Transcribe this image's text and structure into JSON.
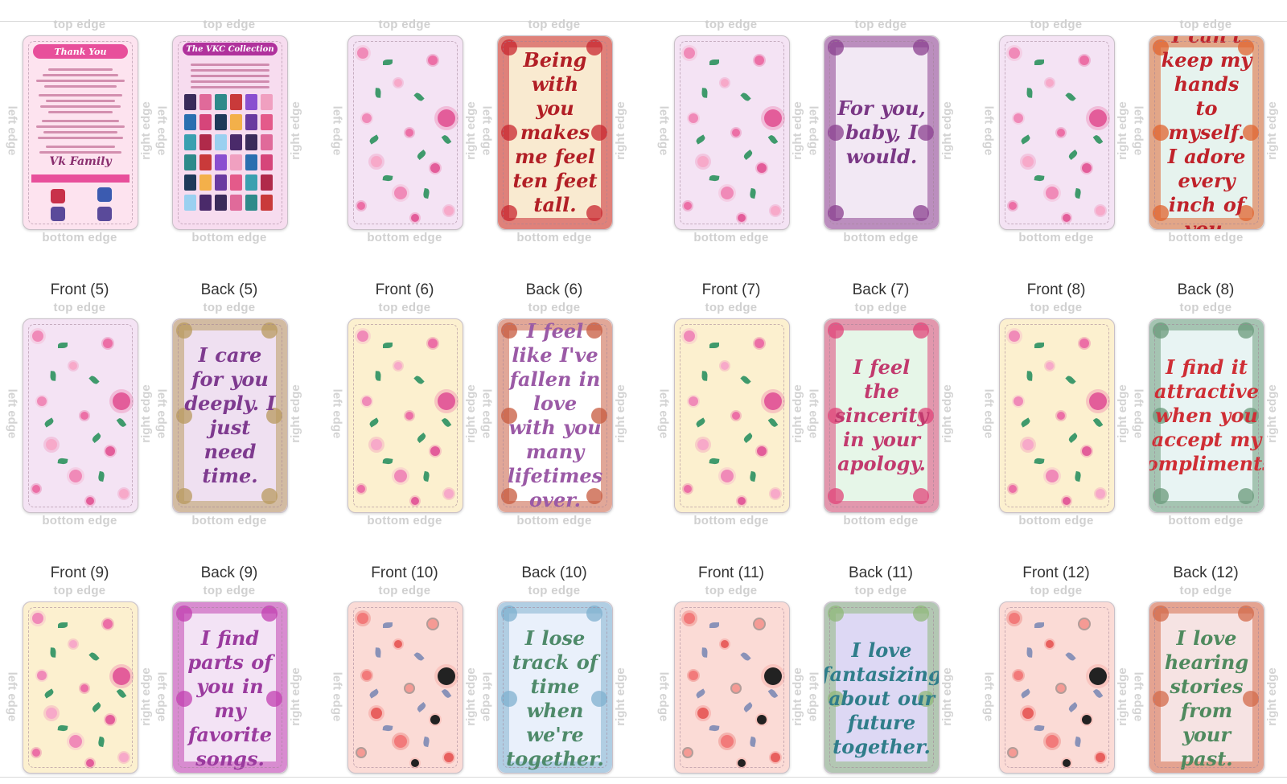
{
  "edge_labels": {
    "top": "top edge",
    "bottom": "bottom edge",
    "left": "left edge",
    "right": "right edge"
  },
  "rows": [
    {
      "slots": [
        {
          "label": "",
          "type": "thankyou",
          "header": "Thank You",
          "sign": "Vk Family"
        },
        {
          "label": "",
          "type": "collection",
          "header": "The VKC Collection"
        },
        {
          "label": "",
          "type": "pattern",
          "pattern": "lilac"
        },
        {
          "label": "",
          "type": "quote",
          "text": "Being with you makes me feel ten feet tall.",
          "bg": "#f9ead0",
          "border": "#c8262f",
          "color": "#b21f26"
        },
        {
          "label": "",
          "type": "pattern",
          "pattern": "lilac"
        },
        {
          "label": "",
          "type": "quote",
          "text": "For you, baby, I would.",
          "bg": "#f2e8f4",
          "border": "#8a3f8f",
          "color": "#7a3785"
        },
        {
          "label": "",
          "type": "pattern",
          "pattern": "lilac"
        },
        {
          "label": "",
          "type": "quote",
          "text": "I can't keep my hands to myself. I adore every inch of you.",
          "bg": "#e6f3ee",
          "border": "#e0632e",
          "color": "#c0222a"
        }
      ]
    },
    {
      "slots": [
        {
          "label": "Front (5)",
          "type": "pattern",
          "pattern": "lilac"
        },
        {
          "label": "Back (5)",
          "type": "quote",
          "text": "I care for you deeply. I just need time.",
          "bg": "#efe0f1",
          "border": "#b89a5e",
          "color": "#7e3a8f"
        },
        {
          "label": "Front (6)",
          "type": "pattern",
          "pattern": "cream"
        },
        {
          "label": "Back (6)",
          "type": "quote",
          "text": "I feel like I've fallen in love with you many lifetimes over.",
          "bg": "#ffffff",
          "border": "#c75a3e",
          "color": "#9b5aa6"
        },
        {
          "label": "Front (7)",
          "type": "pattern",
          "pattern": "cream"
        },
        {
          "label": "Back (7)",
          "type": "quote",
          "text": "I feel the sincerity in your apology.",
          "bg": "#e6f6e8",
          "border": "#e0447a",
          "color": "#c23a6e"
        },
        {
          "label": "Front (8)",
          "type": "pattern",
          "pattern": "cream"
        },
        {
          "label": "Back (8)",
          "type": "quote",
          "text": "I find it attractive when you accept my compliments.",
          "bg": "#e8f4f3",
          "border": "#6a9a7a",
          "color": "#cf2e35"
        }
      ]
    },
    {
      "slots": [
        {
          "label": "Front (9)",
          "type": "pattern",
          "pattern": "cream"
        },
        {
          "label": "Back (9)",
          "type": "quote",
          "text": "I find parts of you in my favorite songs.",
          "bg": "#f3e3f5",
          "border": "#c13fb0",
          "color": "#9a3a9e"
        },
        {
          "label": "Front (10)",
          "type": "pattern",
          "pattern": "peach"
        },
        {
          "label": "Back (10)",
          "type": "quote",
          "text": "I lose track of time when we're together.",
          "bg": "#e9f0fb",
          "border": "#7fb0cf",
          "color": "#4e8a6a"
        },
        {
          "label": "Front (11)",
          "type": "pattern",
          "pattern": "peach"
        },
        {
          "label": "Back (11)",
          "type": "quote",
          "text": "I love fantasizing about our future together.",
          "bg": "#ddd8f4",
          "border": "#8fb87a",
          "color": "#2f7d8a"
        },
        {
          "label": "Front (12)",
          "type": "pattern",
          "pattern": "peach"
        },
        {
          "label": "Back (12)",
          "type": "quote",
          "text": "I love hearing stories from your past.",
          "bg": "#f6e3e3",
          "border": "#d36a4a",
          "color": "#4f8a5e"
        }
      ]
    }
  ]
}
